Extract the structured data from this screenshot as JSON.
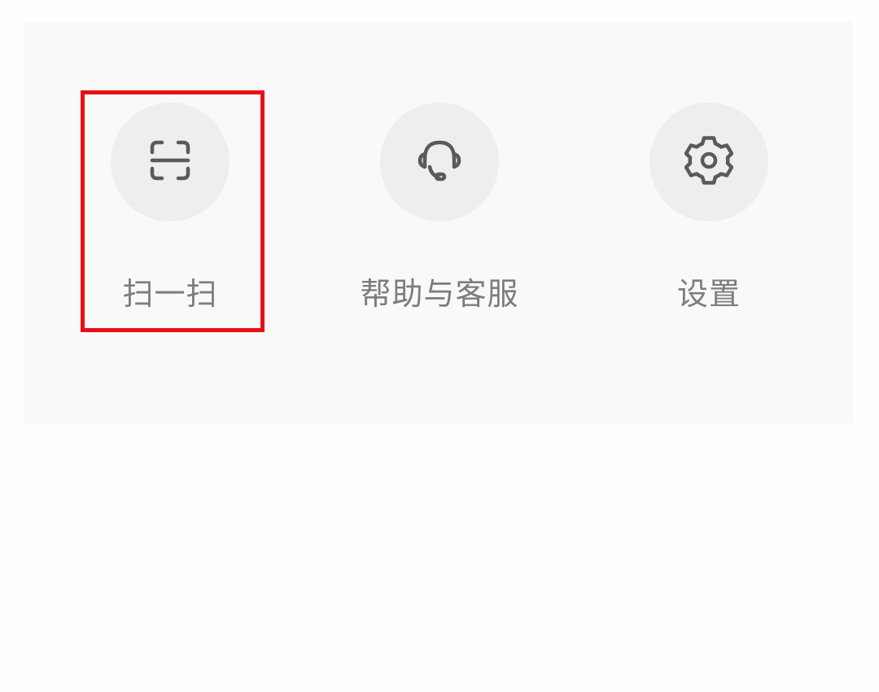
{
  "actions": [
    {
      "id": "scan",
      "label": "扫一扫",
      "icon": "scan-icon"
    },
    {
      "id": "help",
      "label": "帮助与客服",
      "icon": "headset-icon"
    },
    {
      "id": "settings",
      "label": "设置",
      "icon": "gear-icon"
    }
  ],
  "colors": {
    "panel_background": "#f9f9f9",
    "icon_circle": "#eeeeee",
    "icon_stroke": "#5a5a5a",
    "label_text": "#7d7d7d",
    "highlight": "#e90f17"
  }
}
